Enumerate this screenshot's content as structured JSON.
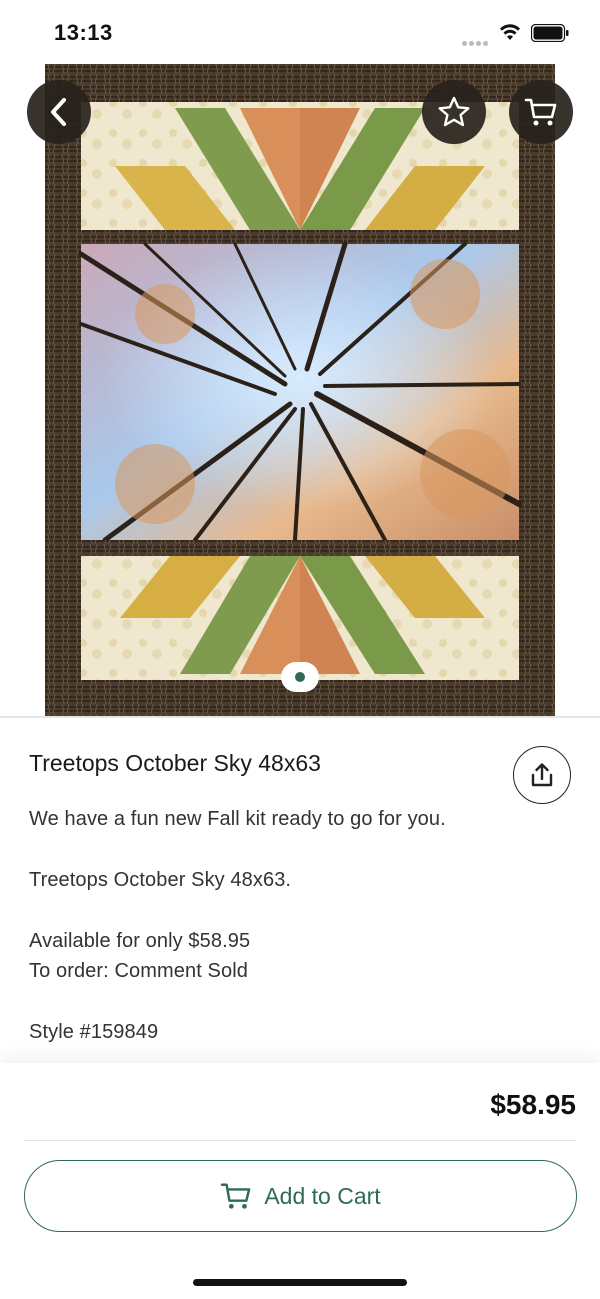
{
  "status_bar": {
    "time": "13:13"
  },
  "product": {
    "title": "Treetops October Sky 48x63",
    "description": [
      "We have a fun new Fall kit ready to go for you.",
      "Treetops October Sky 48x63.",
      "Available for only $58.95",
      "To order: Comment Sold",
      "Style #159849"
    ],
    "image_alt": "Quilt with treetops sky panel and star blocks",
    "image_count": 1,
    "current_image": 1
  },
  "footer": {
    "price": "$58.95",
    "add_to_cart_label": "Add to Cart"
  },
  "icons": {
    "back": "chevron-left-icon",
    "favorite": "star-icon",
    "cart": "cart-icon",
    "share": "share-icon"
  },
  "colors": {
    "accent": "#2e6a5c",
    "button_overlay": "#28221c"
  }
}
